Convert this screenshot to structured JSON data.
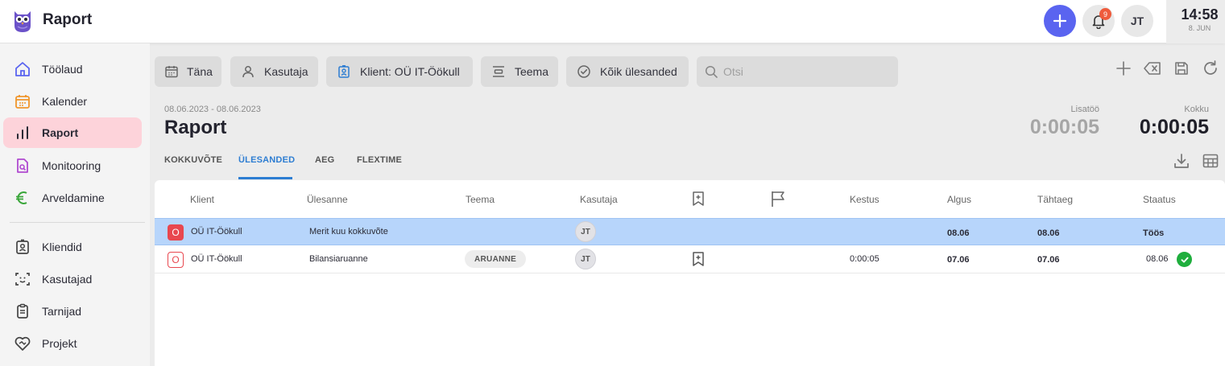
{
  "app": {
    "title": "Raport"
  },
  "topbar": {
    "notifications_count": "9",
    "avatar_initials": "JT",
    "time": "14:58",
    "date": "8. JUN"
  },
  "sidebar": {
    "items": [
      {
        "label": "Töölaud",
        "icon": "home-icon"
      },
      {
        "label": "Kalender",
        "icon": "calendar-icon"
      },
      {
        "label": "Raport",
        "icon": "bar-chart-icon",
        "active": true
      },
      {
        "label": "Monitooring",
        "icon": "document-search-icon"
      },
      {
        "label": "Arveldamine",
        "icon": "euro-icon"
      },
      {
        "label": "Kliendid",
        "icon": "contact-card-icon"
      },
      {
        "label": "Kasutajad",
        "icon": "face-scan-icon"
      },
      {
        "label": "Tarnijad",
        "icon": "clipboard-icon"
      },
      {
        "label": "Projekt",
        "icon": "heart-handshake-icon"
      }
    ]
  },
  "filters": {
    "today": "Täna",
    "user": "Kasutaja",
    "client": "Klient: OÜ IT-Öökull",
    "topic": "Teema",
    "tasks": "Kõik ülesanded",
    "search_placeholder": "Otsi"
  },
  "header": {
    "date_range": "08.06.2023 - 08.06.2023",
    "title": "Raport",
    "extra_label": "Lisatöö",
    "extra_value": "0:00:05",
    "total_label": "Kokku",
    "total_value": "0:00:05"
  },
  "tabs": [
    {
      "label": "KOKKUVÕTE"
    },
    {
      "label": "ÜLESANDED",
      "active": true
    },
    {
      "label": "AEG"
    },
    {
      "label": "FLEXTIME"
    }
  ],
  "table": {
    "columns": {
      "client": "Klient",
      "task": "Ülesanne",
      "topic": "Teema",
      "user": "Kasutaja",
      "duration": "Kestus",
      "start": "Algus",
      "deadline": "Tähtaeg",
      "status": "Staatus"
    },
    "rows": [
      {
        "badge": "O",
        "client": "OÜ IT-Öökull",
        "task": "Merit kuu kokkuvõte",
        "topic": "",
        "user": "JT",
        "duration": "",
        "start": "08.06",
        "deadline": "08.06",
        "status": "Töös",
        "selected": true
      },
      {
        "badge": "O",
        "client": "OÜ IT-Öökull",
        "task": "Bilansiaruanne",
        "topic": "ARUANNE",
        "user": "JT",
        "duration": "0:00:05",
        "start": "07.06",
        "deadline": "07.06",
        "status": "08.06",
        "done": true
      }
    ]
  },
  "colors": {
    "accent": "#5a64f0",
    "active_nav": "#fdd3da",
    "tab_active": "#2d7dd2",
    "selected_row": "#b7d5fb",
    "client_badge": "#e8474f",
    "done": "#1fae3d"
  }
}
